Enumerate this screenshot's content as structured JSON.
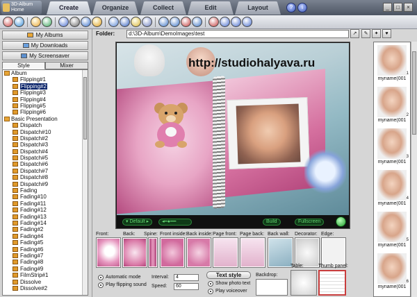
{
  "app": {
    "logo_text_1": "3D-Album",
    "logo_text_2": "Home"
  },
  "tabs": [
    {
      "label": "Create",
      "active": true
    },
    {
      "label": "Organize",
      "active": false
    },
    {
      "label": "Collect",
      "active": false
    },
    {
      "label": "Edit",
      "active": false
    },
    {
      "label": "Layout",
      "active": false
    }
  ],
  "left_nav": {
    "my_albums": "My Albums",
    "my_downloads": "My Downloads",
    "my_screensaver": "My Screensaver",
    "style_tab": "Style",
    "mixer_tab": "Mixer"
  },
  "tree": [
    {
      "type": "group",
      "label": "Album"
    },
    {
      "type": "leaf",
      "label": "Flipping#1"
    },
    {
      "type": "leaf",
      "label": "Flipping#2",
      "selected": true
    },
    {
      "type": "leaf",
      "label": "Flipping#3"
    },
    {
      "type": "leaf",
      "label": "Flipping#4"
    },
    {
      "type": "leaf",
      "label": "Flipping#5"
    },
    {
      "type": "leaf",
      "label": "Flipping#6"
    },
    {
      "type": "group",
      "label": "Basic Presentation"
    },
    {
      "type": "leaf",
      "label": "Dispatch"
    },
    {
      "type": "leaf",
      "label": "Dispatch#10"
    },
    {
      "type": "leaf",
      "label": "Dispatch#2"
    },
    {
      "type": "leaf",
      "label": "Dispatch#3"
    },
    {
      "type": "leaf",
      "label": "Dispatch#4"
    },
    {
      "type": "leaf",
      "label": "Dispatch#5"
    },
    {
      "type": "leaf",
      "label": "Dispatch#6"
    },
    {
      "type": "leaf",
      "label": "Dispatch#7"
    },
    {
      "type": "leaf",
      "label": "Dispatch#8"
    },
    {
      "type": "leaf",
      "label": "Dispatch#9"
    },
    {
      "type": "leaf",
      "label": "Fading"
    },
    {
      "type": "leaf",
      "label": "Fading#10"
    },
    {
      "type": "leaf",
      "label": "Fading#11"
    },
    {
      "type": "leaf",
      "label": "Fading#12"
    },
    {
      "type": "leaf",
      "label": "Fading#13"
    },
    {
      "type": "leaf",
      "label": "Fading#14"
    },
    {
      "type": "leaf",
      "label": "Fading#2"
    },
    {
      "type": "leaf",
      "label": "Fading#4"
    },
    {
      "type": "leaf",
      "label": "Fading#5"
    },
    {
      "type": "leaf",
      "label": "Fading#6"
    },
    {
      "type": "leaf",
      "label": "Fading#7"
    },
    {
      "type": "leaf",
      "label": "Fading#8"
    },
    {
      "type": "leaf",
      "label": "Fading#9"
    },
    {
      "type": "leaf",
      "label": "FilmStrip#1"
    },
    {
      "type": "leaf",
      "label": "Dissolve"
    },
    {
      "type": "leaf",
      "label": "Dissolve#2"
    }
  ],
  "folder": {
    "label": "Folder:",
    "path": "d:\\3D-Album\\DemoImages\\test"
  },
  "preview": {
    "watermark": "http://studiohalyava.ru",
    "default_btn": "Default",
    "build_btn": "Build",
    "fullscreen_btn": "Fullscreen"
  },
  "components": {
    "front": "Front:",
    "back": "Back:",
    "spine": "Spine:",
    "front_inside": "Front inside:",
    "back_inside": "Back inside:",
    "page_front": "Page front:",
    "page_back": "Page back:",
    "back_wall": "Back wall:",
    "decorator": "Decorator:",
    "edge": "Edge:"
  },
  "controls": {
    "automatic_mode": "Automatic mode",
    "play_flipping_sound": "Play flipping sound",
    "interval_label": "Interval:",
    "interval_value": "4",
    "speed_label": "Speed:",
    "speed_value": "60",
    "text_style": "Text style",
    "show_photo_text": "Show photo text",
    "play_voiceover": "Play voiceover",
    "backdrop": "Backdrop:",
    "table": "Table:",
    "thumb_panel": "Thumb panel:"
  },
  "thumbnails": [
    {
      "caption": "myname(001",
      "num": "1"
    },
    {
      "caption": "myname(001",
      "num": "2"
    },
    {
      "caption": "myname(001",
      "num": "3"
    },
    {
      "caption": "myname(001",
      "num": "4"
    },
    {
      "caption": "myname(001",
      "num": "5"
    },
    {
      "caption": "myname(001",
      "num": "6"
    }
  ]
}
